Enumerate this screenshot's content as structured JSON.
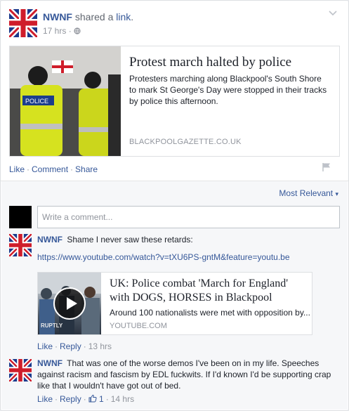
{
  "post": {
    "author": "NWNF",
    "action_text": "shared a",
    "action_link": "link",
    "action_end": ".",
    "time": "17 hrs",
    "separator": "·",
    "audience_icon": "globe-icon",
    "menu_icon": "chevron-down-icon"
  },
  "link_preview": {
    "title": "Protest march halted by police",
    "description": "Protesters marching along Blackpool's South Shore to mark St George's Day were stopped in their tracks by police this afternoon.",
    "domain": "BLACKPOOLGAZETTE.CO.UK",
    "thumb_sign": "POLICE"
  },
  "actions": {
    "like": "Like",
    "comment": "Comment",
    "share": "Share",
    "dot": "·"
  },
  "comments_section": {
    "sort_label": "Most Relevant",
    "sort_caret": "▾",
    "compose_placeholder": "Write a comment..."
  },
  "comments": [
    {
      "author": "NWNF",
      "text": "Shame I never saw these retards:",
      "url": "https://www.youtube.com/watch?v=tXU6PS-gntM&feature=youtu.be",
      "like_label": "Like",
      "reply_label": "Reply",
      "time": "13 hrs",
      "dot": "·"
    },
    {
      "author": "NWNF",
      "text": "That was one of the worse demos I've been on in my life. Speeches against racism and fascism by EDL fuckwits. If I'd known I'd be supporting crap like that I wouldn't have got out of bed.",
      "like_label": "Like",
      "reply_label": "Reply",
      "like_count": "1",
      "time": "14 hrs",
      "dot": "·"
    }
  ],
  "video_preview": {
    "title": "UK: Police combat 'March for England' with DOGS, HORSES in Blackpool",
    "description": "Around 100 nationalists were met with opposition by...",
    "domain": "YOUTUBE.COM",
    "thumb_text": "RUPTLY"
  },
  "colors": {
    "link": "#365899",
    "meta": "#90949c",
    "flag_blue": "#1b3a8c",
    "flag_red": "#cf1d2b"
  }
}
